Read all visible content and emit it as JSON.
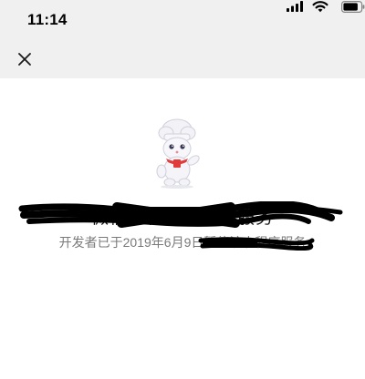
{
  "status_bar": {
    "time": "11:14",
    "icons": [
      "signal-icon",
      "wifi-icon",
      "battery-icon"
    ]
  },
  "nav": {
    "close_icon": "close-icon"
  },
  "content": {
    "mascot_icon": "mascot-chef-icon",
    "title": "微信小程序已暂停服务",
    "message": "开发者已于2019年6月9日暂停该小程序服务"
  },
  "colors": {
    "top_background": "#f0f0f0",
    "page_background": "#ffffff",
    "message_text": "#7a7a7a",
    "redaction": "#000000"
  }
}
